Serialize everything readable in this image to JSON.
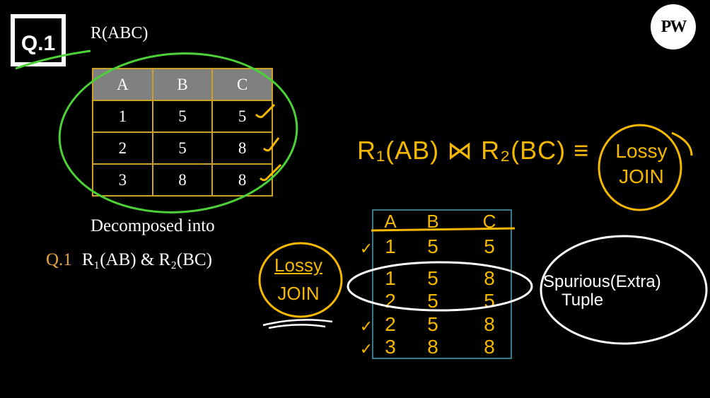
{
  "slide": {
    "question_badge": "Q.1",
    "relation_title": "R(ABC)",
    "table": {
      "headers": [
        "A",
        "B",
        "C"
      ],
      "rows": [
        [
          "1",
          "5",
          "5"
        ],
        [
          "2",
          "5",
          "8"
        ],
        [
          "3",
          "8",
          "8"
        ]
      ]
    },
    "decomposed_label": "Decomposed into",
    "question_number": "Q.1",
    "decomposition_text": "R₁(AB) & R₂(BC)",
    "logo_text": "PW"
  },
  "annotations": {
    "equation": "R₁(AB) ⋈ R₂(BC) ≡",
    "lossy_join_top": [
      "Lossy",
      "JOIN"
    ],
    "lossy_join_left": [
      "Lossy",
      "JOIN"
    ],
    "join_result": {
      "headers": [
        "A",
        "B",
        "C"
      ],
      "rows": [
        [
          "1",
          "5",
          "5"
        ],
        [
          "1",
          "5",
          "8"
        ],
        [
          "2",
          "5",
          "5"
        ],
        [
          "2",
          "5",
          "8"
        ],
        [
          "3",
          "8",
          "8"
        ]
      ],
      "check_mark": "✓"
    },
    "spurious_label": [
      "Spurious(Extra)",
      "Tuple"
    ],
    "colors": {
      "yellow": "#f5b800",
      "green": "#4cd137",
      "white": "#ffffff",
      "box": "#4aa3b8",
      "table_border": "#c9a227",
      "orange": "#e8a33c"
    }
  }
}
